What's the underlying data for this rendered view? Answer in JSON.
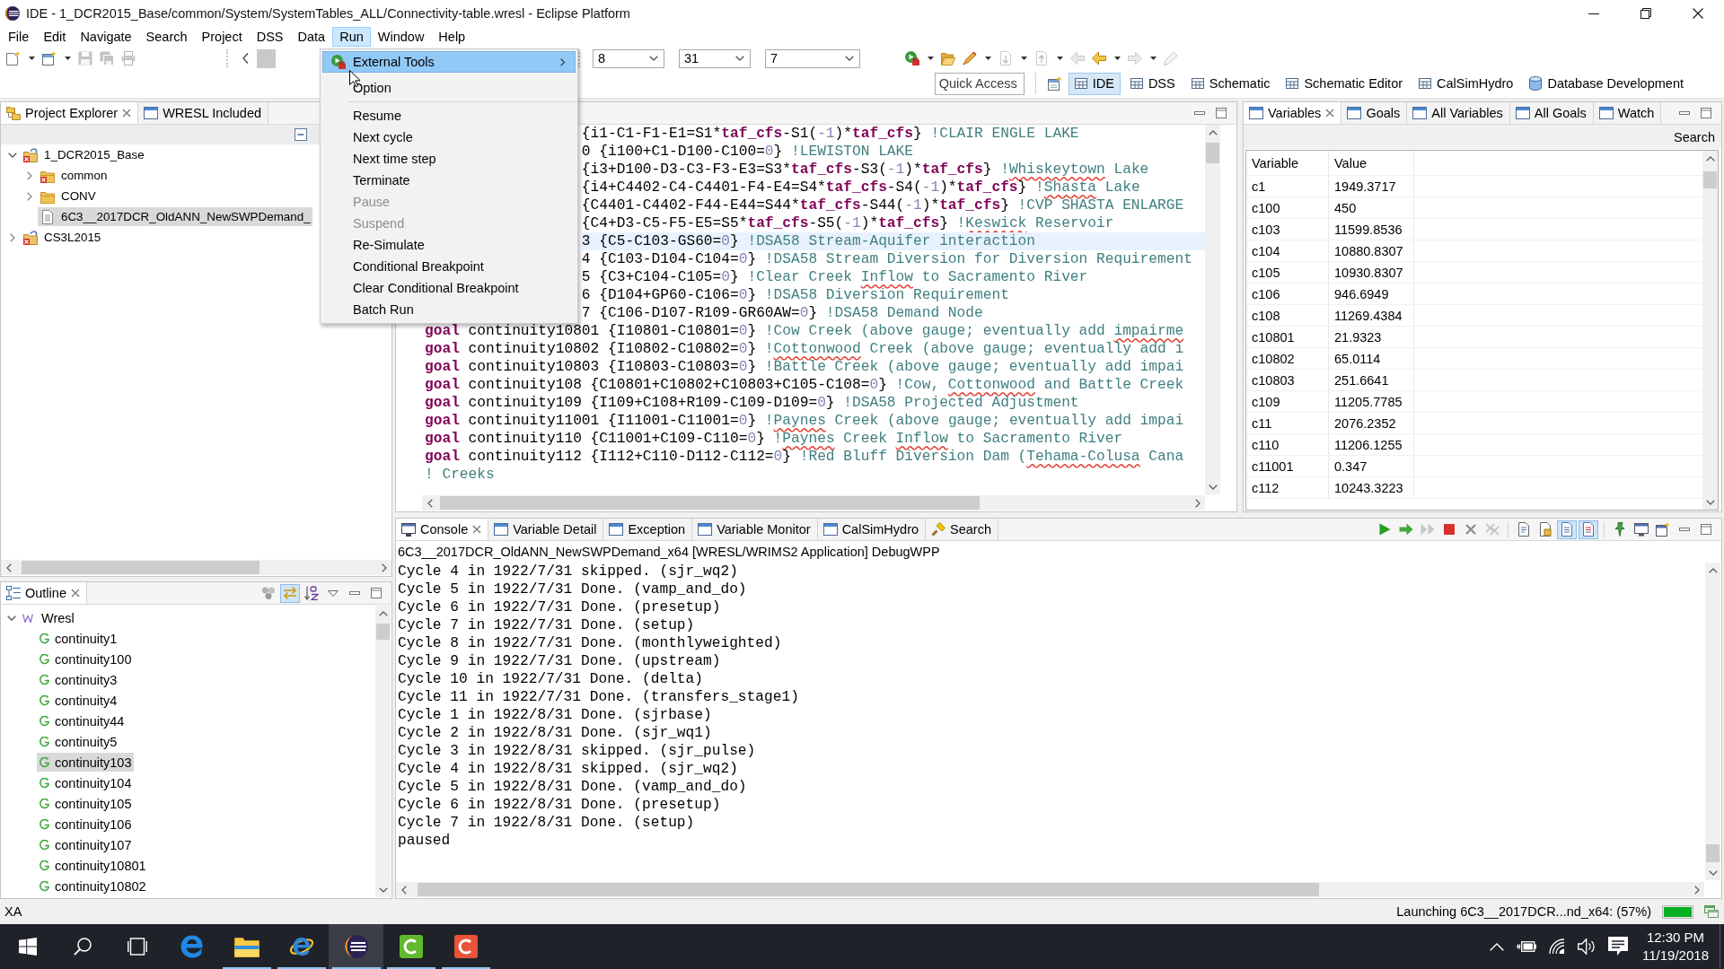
{
  "window": {
    "title": "IDE - 1_DCR2015_Base/common/System/SystemTables_ALL/Connectivity-table.wresl - Eclipse Platform"
  },
  "menu_bar": [
    {
      "label": "File",
      "selected": false
    },
    {
      "label": "Edit",
      "selected": false
    },
    {
      "label": "Navigate",
      "selected": false
    },
    {
      "label": "Search",
      "selected": false
    },
    {
      "label": "Project",
      "selected": false
    },
    {
      "label": "DSS",
      "selected": false
    },
    {
      "label": "Data",
      "selected": false
    },
    {
      "label": "Run",
      "selected": true
    },
    {
      "label": "Window",
      "selected": false
    },
    {
      "label": "Help",
      "selected": false
    }
  ],
  "toolbar": {
    "left_buttons": [
      {
        "kind": "new-file",
        "dropdown": true,
        "disabled": false
      },
      {
        "kind": "new-project",
        "dropdown": true,
        "disabled": false
      },
      {
        "kind": "save",
        "dropdown": false,
        "disabled": true
      },
      {
        "kind": "save-all",
        "dropdown": false,
        "disabled": true
      },
      {
        "kind": "print",
        "dropdown": false,
        "disabled": true
      }
    ],
    "combos": [
      {
        "value": "8"
      },
      {
        "value": "31"
      },
      {
        "value": "7"
      }
    ],
    "right_buttons": [
      {
        "kind": "run-tools",
        "dropdown": true,
        "disabled": false
      },
      {
        "kind": "open-folder",
        "dropdown": false,
        "disabled": false
      },
      {
        "kind": "brush",
        "dropdown": true,
        "disabled": false
      },
      {
        "kind": "page-down",
        "dropdown": true,
        "disabled": true
      },
      {
        "kind": "page-up",
        "dropdown": true,
        "disabled": true
      },
      {
        "kind": "back",
        "dropdown": false,
        "disabled": true
      },
      {
        "kind": "back",
        "dropdown": true,
        "disabled": false
      },
      {
        "kind": "forward",
        "dropdown": true,
        "disabled": true
      },
      {
        "kind": "pen",
        "dropdown": false,
        "disabled": true
      }
    ],
    "quick_access": {
      "placeholder": "Quick Access"
    },
    "perspectives": [
      {
        "label": "IDE",
        "kind": "table",
        "selected": true
      },
      {
        "label": "DSS",
        "kind": "table",
        "selected": false
      },
      {
        "label": "Schematic",
        "kind": "table",
        "selected": false
      },
      {
        "label": "Schematic Editor",
        "kind": "table",
        "selected": false
      },
      {
        "label": "CalSimHydro",
        "kind": "table",
        "selected": false
      },
      {
        "label": "Database Development",
        "kind": "database",
        "selected": false
      }
    ]
  },
  "run_menu": {
    "items": [
      {
        "label": "External Tools",
        "kind": "launcher",
        "selected": true,
        "disabled": false
      },
      {
        "label": "Option",
        "kind": "command",
        "selected": false,
        "disabled": false
      },
      {
        "kind": "separator"
      },
      {
        "label": "Resume",
        "kind": "command",
        "selected": false,
        "disabled": false
      },
      {
        "label": "Next cycle",
        "kind": "command",
        "selected": false,
        "disabled": false
      },
      {
        "label": "Next time step",
        "kind": "command",
        "selected": false,
        "disabled": false
      },
      {
        "label": "Terminate",
        "kind": "command",
        "selected": false,
        "disabled": false
      },
      {
        "label": "Pause",
        "kind": "command",
        "selected": false,
        "disabled": true
      },
      {
        "label": "Suspend",
        "kind": "command",
        "selected": false,
        "disabled": true
      },
      {
        "label": "Re-Simulate",
        "kind": "command",
        "selected": false,
        "disabled": false
      },
      {
        "label": "Conditional Breakpoint",
        "kind": "command",
        "selected": false,
        "disabled": false
      },
      {
        "label": "Clear Conditional Breakpoint",
        "kind": "command",
        "selected": false,
        "disabled": false
      },
      {
        "label": "Batch Run",
        "kind": "command",
        "selected": false,
        "disabled": false
      }
    ]
  },
  "project_explorer": {
    "tabs": [
      {
        "label": "Project Explorer",
        "kind": "explorer",
        "selected": true
      },
      {
        "label": "WRESL Included",
        "kind": "view",
        "selected": false
      }
    ],
    "tree": [
      {
        "label": "1_DCR2015_Base",
        "kind": "project",
        "error": true,
        "expanded": true,
        "selected": false,
        "children": [
          {
            "label": "common",
            "kind": "folder",
            "error": true,
            "expanded": false,
            "selected": false
          },
          {
            "label": "CONV",
            "kind": "folder",
            "error": false,
            "expanded": false,
            "selected": false
          },
          {
            "label": "6C3__2017DCR_OldANN_NewSWPDemand_",
            "kind": "file",
            "selected": true
          }
        ]
      },
      {
        "label": "CS3L2015",
        "kind": "project",
        "error": true,
        "expanded": false,
        "selected": false
      }
    ]
  },
  "outline": {
    "tabs": [
      {
        "label": "Outline",
        "kind": "outline",
        "selected": true
      }
    ],
    "toolbar": [
      {
        "kind": "filter",
        "on": false
      },
      {
        "kind": "link",
        "on": true
      },
      {
        "kind": "sort",
        "on": false
      }
    ],
    "tree": [
      {
        "label": "Wresl",
        "kind": "root",
        "expanded": true,
        "selected": false,
        "children": [
          {
            "label": "continuity1",
            "kind": "goal",
            "selected": false
          },
          {
            "label": "continuity100",
            "kind": "goal",
            "selected": false
          },
          {
            "label": "continuity3",
            "kind": "goal",
            "selected": false
          },
          {
            "label": "continuity4",
            "kind": "goal",
            "selected": false
          },
          {
            "label": "continuity44",
            "kind": "goal",
            "selected": false
          },
          {
            "label": "continuity5",
            "kind": "goal",
            "selected": false
          },
          {
            "label": "continuity103",
            "kind": "goal",
            "selected": true
          },
          {
            "label": "continuity104",
            "kind": "goal",
            "selected": false
          },
          {
            "label": "continuity105",
            "kind": "goal",
            "selected": false
          },
          {
            "label": "continuity106",
            "kind": "goal",
            "selected": false
          },
          {
            "label": "continuity107",
            "kind": "goal",
            "selected": false
          },
          {
            "label": "continuity10801",
            "kind": "goal",
            "selected": false
          },
          {
            "label": "continuity10802",
            "kind": "goal",
            "selected": false
          }
        ]
      }
    ]
  },
  "editor": {
    "lines": [
      {
        "kind": "partial",
        "current": false,
        "segments": [
          {
            "kind": "plain",
            "text": "{i1-C1-F1-E1=S1*"
          },
          {
            "kind": "var",
            "text": "taf_cfs"
          },
          {
            "kind": "plain",
            "text": "-S1("
          },
          {
            "kind": "number",
            "text": "-1"
          },
          {
            "kind": "plain",
            "text": ")*"
          },
          {
            "kind": "var",
            "text": "taf_cfs"
          },
          {
            "kind": "plain",
            "text": "}"
          },
          {
            "kind": "comment",
            "text": " !CLAIR ENGLE LAKE"
          }
        ]
      },
      {
        "kind": "partial",
        "current": false,
        "segments": [
          {
            "kind": "plain",
            "text": "0 {i100+C1-D100-C100="
          },
          {
            "kind": "number",
            "text": "0"
          },
          {
            "kind": "plain",
            "text": "}"
          },
          {
            "kind": "comment",
            "text": " !LEWISTON LAKE"
          }
        ]
      },
      {
        "kind": "partial",
        "current": false,
        "segments": [
          {
            "kind": "plain",
            "text": "{i3+D100-D3-C3-F3-E3=S3*"
          },
          {
            "kind": "var",
            "text": "taf_cfs"
          },
          {
            "kind": "plain",
            "text": "-S3("
          },
          {
            "kind": "number",
            "text": "-1"
          },
          {
            "kind": "plain",
            "text": ")*"
          },
          {
            "kind": "var",
            "text": "taf_cfs"
          },
          {
            "kind": "plain",
            "text": "}"
          },
          {
            "kind": "comment",
            "text": " !"
          },
          {
            "kind": "typo",
            "text": "Whiskeytown"
          },
          {
            "kind": "comment",
            "text": " Lake"
          }
        ]
      },
      {
        "kind": "partial",
        "current": false,
        "segments": [
          {
            "kind": "plain",
            "text": "{i4+C4402-C4-C4401-F4-E4=S4*"
          },
          {
            "kind": "var",
            "text": "taf_cfs"
          },
          {
            "kind": "plain",
            "text": "-S4("
          },
          {
            "kind": "number",
            "text": "-1"
          },
          {
            "kind": "plain",
            "text": ")*"
          },
          {
            "kind": "var",
            "text": "taf_cfs"
          },
          {
            "kind": "plain",
            "text": "}"
          },
          {
            "kind": "comment",
            "text": " !"
          },
          {
            "kind": "typo",
            "text": "Shasta"
          },
          {
            "kind": "comment",
            "text": " Lake"
          }
        ]
      },
      {
        "kind": "partial",
        "current": false,
        "segments": [
          {
            "kind": "plain",
            "text": "{C4401-C4402-F44-E44=S44*"
          },
          {
            "kind": "var",
            "text": "taf_cfs"
          },
          {
            "kind": "plain",
            "text": "-S44("
          },
          {
            "kind": "number",
            "text": "-1"
          },
          {
            "kind": "plain",
            "text": ")*"
          },
          {
            "kind": "var",
            "text": "taf_cfs"
          },
          {
            "kind": "plain",
            "text": "}"
          },
          {
            "kind": "comment",
            "text": " !CVP SHASTA ENLARGE"
          }
        ]
      },
      {
        "kind": "partial",
        "current": false,
        "segments": [
          {
            "kind": "plain",
            "text": "{C4+D3-C5-F5-E5=S5*"
          },
          {
            "kind": "var",
            "text": "taf_cfs"
          },
          {
            "kind": "plain",
            "text": "-S5("
          },
          {
            "kind": "number",
            "text": "-1"
          },
          {
            "kind": "plain",
            "text": ")*"
          },
          {
            "kind": "var",
            "text": "taf_cfs"
          },
          {
            "kind": "plain",
            "text": "}"
          },
          {
            "kind": "comment",
            "text": " !"
          },
          {
            "kind": "typo",
            "text": "Keswick"
          },
          {
            "kind": "comment",
            "text": " Reservoir"
          }
        ]
      },
      {
        "kind": "partial",
        "current": true,
        "segments": [
          {
            "kind": "plain",
            "text": "3 {C5-C103-GS60="
          },
          {
            "kind": "number",
            "text": "0"
          },
          {
            "kind": "plain",
            "text": "}"
          },
          {
            "kind": "comment",
            "text": " !DSA58 Stream-Aquifer interaction"
          }
        ]
      },
      {
        "kind": "partial",
        "current": false,
        "segments": [
          {
            "kind": "plain",
            "text": "4 {C103-D104-C104="
          },
          {
            "kind": "number",
            "text": "0"
          },
          {
            "kind": "plain",
            "text": "}"
          },
          {
            "kind": "comment",
            "text": " !DSA58 Stream Diversion for Diversion Requirement"
          }
        ]
      },
      {
        "kind": "partial",
        "current": false,
        "segments": [
          {
            "kind": "plain",
            "text": "5 {C3+C104-C105="
          },
          {
            "kind": "number",
            "text": "0"
          },
          {
            "kind": "plain",
            "text": "}"
          },
          {
            "kind": "comment",
            "text": " !Clear Creek "
          },
          {
            "kind": "typo",
            "text": "Inflow"
          },
          {
            "kind": "comment",
            "text": " to Sacramento River"
          }
        ]
      },
      {
        "kind": "partial",
        "current": false,
        "segments": [
          {
            "kind": "plain",
            "text": "6 {D104+GP60-C106="
          },
          {
            "kind": "number",
            "text": "0"
          },
          {
            "kind": "plain",
            "text": "}"
          },
          {
            "kind": "comment",
            "text": " !DSA58 Diversion Requirement"
          }
        ]
      },
      {
        "kind": "partial",
        "current": false,
        "segments": [
          {
            "kind": "plain",
            "text": "7 {C106-D107-R109-GR60AW="
          },
          {
            "kind": "number",
            "text": "0"
          },
          {
            "kind": "plain",
            "text": "}"
          },
          {
            "kind": "comment",
            "text": " !DSA58 Demand Node"
          }
        ]
      },
      {
        "kind": "full",
        "current": false,
        "segments": [
          {
            "kind": "keyword",
            "text": "goal"
          },
          {
            "kind": "plain",
            "text": " continuity10801 {I10801-C10801="
          },
          {
            "kind": "number",
            "text": "0"
          },
          {
            "kind": "plain",
            "text": "}"
          },
          {
            "kind": "comment",
            "text": " !Cow Creek (above gauge; eventually add "
          },
          {
            "kind": "typo",
            "text": "impairme"
          }
        ]
      },
      {
        "kind": "full",
        "current": false,
        "segments": [
          {
            "kind": "keyword",
            "text": "goal"
          },
          {
            "kind": "plain",
            "text": " continuity10802 {I10802-C10802="
          },
          {
            "kind": "number",
            "text": "0"
          },
          {
            "kind": "plain",
            "text": "}"
          },
          {
            "kind": "comment",
            "text": " !"
          },
          {
            "kind": "typo",
            "text": "Cottonwood"
          },
          {
            "kind": "comment",
            "text": " Creek (above gauge; eventually add i"
          }
        ]
      },
      {
        "kind": "full",
        "current": false,
        "segments": [
          {
            "kind": "keyword",
            "text": "goal"
          },
          {
            "kind": "plain",
            "text": " continuity10803 {I10803-C10803="
          },
          {
            "kind": "number",
            "text": "0"
          },
          {
            "kind": "plain",
            "text": "}"
          },
          {
            "kind": "comment",
            "text": " !Battle Creek (above gauge; eventually add impai"
          }
        ]
      },
      {
        "kind": "full",
        "current": false,
        "segments": [
          {
            "kind": "keyword",
            "text": "goal"
          },
          {
            "kind": "plain",
            "text": " continuity108 {C10801+C10802+C10803+C105-C108="
          },
          {
            "kind": "number",
            "text": "0"
          },
          {
            "kind": "plain",
            "text": "}"
          },
          {
            "kind": "comment",
            "text": " !Cow, "
          },
          {
            "kind": "typo",
            "text": "Cottonwood"
          },
          {
            "kind": "comment",
            "text": " and Battle Creek"
          }
        ]
      },
      {
        "kind": "full",
        "current": false,
        "segments": [
          {
            "kind": "keyword",
            "text": "goal"
          },
          {
            "kind": "plain",
            "text": " continuity109 {I109+C108+R109-C109-D109="
          },
          {
            "kind": "number",
            "text": "0"
          },
          {
            "kind": "plain",
            "text": "}"
          },
          {
            "kind": "comment",
            "text": " !DSA58 Projected Adjustment"
          }
        ]
      },
      {
        "kind": "full",
        "current": false,
        "segments": [
          {
            "kind": "keyword",
            "text": "goal"
          },
          {
            "kind": "plain",
            "text": " continuity11001 {I11001-C11001="
          },
          {
            "kind": "number",
            "text": "0"
          },
          {
            "kind": "plain",
            "text": "}"
          },
          {
            "kind": "comment",
            "text": " !"
          },
          {
            "kind": "typo",
            "text": "Paynes"
          },
          {
            "kind": "comment",
            "text": " Creek (above gauge; eventually add impai"
          }
        ]
      },
      {
        "kind": "full",
        "current": false,
        "segments": [
          {
            "kind": "keyword",
            "text": "goal"
          },
          {
            "kind": "plain",
            "text": " continuity110 {C11001+C109-C110="
          },
          {
            "kind": "number",
            "text": "0"
          },
          {
            "kind": "plain",
            "text": "}"
          },
          {
            "kind": "comment",
            "text": " !"
          },
          {
            "kind": "typo",
            "text": "Paynes"
          },
          {
            "kind": "comment",
            "text": " Creek "
          },
          {
            "kind": "typo",
            "text": "Inflow"
          },
          {
            "kind": "comment",
            "text": " to Sacramento River"
          }
        ]
      },
      {
        "kind": "full",
        "current": false,
        "segments": [
          {
            "kind": "keyword",
            "text": "goal"
          },
          {
            "kind": "plain",
            "text": " continuity112 {I112+C110-D112-C112="
          },
          {
            "kind": "number",
            "text": "0"
          },
          {
            "kind": "plain",
            "text": "}"
          },
          {
            "kind": "comment",
            "text": " !Red Bluff Diversion Dam ("
          },
          {
            "kind": "typo",
            "text": "Tehama-Colusa"
          },
          {
            "kind": "comment",
            "text": " Cana"
          }
        ]
      },
      {
        "kind": "full",
        "current": false,
        "segments": [
          {
            "kind": "comment",
            "text": "! Creeks"
          }
        ]
      }
    ]
  },
  "variables_view": {
    "tabs": [
      {
        "label": "Variables",
        "kind": "view",
        "selected": true
      },
      {
        "label": "Goals",
        "kind": "view",
        "selected": false
      },
      {
        "label": "All Variables",
        "kind": "view",
        "selected": false
      },
      {
        "label": "All Goals",
        "kind": "view",
        "selected": false
      },
      {
        "label": "Watch",
        "kind": "view",
        "selected": false
      }
    ],
    "search": "Search",
    "columns": [
      "Variable",
      "Value"
    ],
    "rows": [
      [
        "c1",
        "1949.3717"
      ],
      [
        "c100",
        "450"
      ],
      [
        "c103",
        "11599.8536"
      ],
      [
        "c104",
        "10880.8307"
      ],
      [
        "c105",
        "10930.8307"
      ],
      [
        "c106",
        "946.6949"
      ],
      [
        "c108",
        "11269.4384"
      ],
      [
        "c10801",
        "21.9323"
      ],
      [
        "c10802",
        "65.0114"
      ],
      [
        "c10803",
        "251.6641"
      ],
      [
        "c109",
        "11205.7785"
      ],
      [
        "c11",
        "2076.2352"
      ],
      [
        "c110",
        "11206.1255"
      ],
      [
        "c11001",
        "0.347"
      ],
      [
        "c112",
        "10243.3223"
      ]
    ]
  },
  "console": {
    "tabs": [
      {
        "label": "Console",
        "kind": "console",
        "selected": true
      },
      {
        "label": "Variable Detail",
        "kind": "view",
        "selected": false
      },
      {
        "label": "Exception",
        "kind": "view",
        "selected": false
      },
      {
        "label": "Variable Monitor",
        "kind": "view",
        "selected": false
      },
      {
        "label": "CalSimHydro",
        "kind": "view",
        "selected": false
      },
      {
        "label": "Search",
        "kind": "search",
        "selected": false
      }
    ],
    "toolbar": [
      {
        "kind": "run",
        "disabled": false,
        "on": false
      },
      {
        "kind": "step",
        "disabled": false,
        "on": false
      },
      {
        "kind": "resume",
        "disabled": true,
        "on": false
      },
      {
        "kind": "terminate",
        "disabled": false,
        "on": false
      },
      {
        "kind": "remove",
        "disabled": false,
        "on": false
      },
      {
        "kind": "remove-all",
        "disabled": true,
        "on": false
      },
      {
        "kind": "separator"
      },
      {
        "kind": "clear",
        "disabled": false,
        "on": false
      },
      {
        "kind": "scroll-lock",
        "disabled": false,
        "on": false
      },
      {
        "kind": "show-out",
        "disabled": false,
        "on": true
      },
      {
        "kind": "show-err",
        "disabled": false,
        "on": true
      },
      {
        "kind": "separator"
      },
      {
        "kind": "pin",
        "disabled": false,
        "on": false
      },
      {
        "kind": "display",
        "disabled": false,
        "on": false
      },
      {
        "kind": "new-console",
        "disabled": false,
        "on": false
      }
    ],
    "process": "6C3__2017DCR_OldANN_NewSWPDemand_x64 [WRESL/WRIMS2 Application] DebugWPP",
    "lines": [
      "Cycle 4 in 1922/7/31 skipped. (sjr_wq2)",
      "Cycle 5 in 1922/7/31 Done. (vamp_and_do)",
      "Cycle 6 in 1922/7/31 Done. (presetup)",
      "Cycle 7 in 1922/7/31 Done. (setup)",
      "Cycle 8 in 1922/7/31 Done. (monthlyweighted)",
      "Cycle 9 in 1922/7/31 Done. (upstream)",
      "Cycle 10 in 1922/7/31 Done. (delta)",
      "Cycle 11 in 1922/7/31 Done. (transfers_stage1)",
      "Cycle 1 in 1922/8/31 Done. (sjrbase)",
      "Cycle 2 in 1922/8/31 Done. (sjr_wq1)",
      "Cycle 3 in 1922/8/31 skipped. (sjr_pulse)",
      "Cycle 4 in 1922/8/31 skipped. (sjr_wq2)",
      "Cycle 5 in 1922/8/31 Done. (vamp_and_do)",
      "Cycle 6 in 1922/8/31 Done. (presetup)",
      "Cycle 7 in 1922/8/31 Done. (setup)",
      "paused"
    ]
  },
  "status_bar": {
    "message": "XA",
    "task": "Launching 6C3__2017DCR...nd_x64: (57%)",
    "level": 1
  },
  "taskbar": {
    "buttons": [
      {
        "kind": "start",
        "running": false,
        "selected": false
      },
      {
        "kind": "search",
        "running": false,
        "selected": false
      },
      {
        "kind": "task-view",
        "running": false,
        "selected": false
      },
      {
        "kind": "edge",
        "running": false,
        "selected": false
      },
      {
        "kind": "explorer",
        "running": true,
        "selected": false
      },
      {
        "kind": "ie",
        "running": true,
        "selected": false
      },
      {
        "kind": "eclipse",
        "running": true,
        "selected": true
      },
      {
        "kind": "tile-green",
        "running": true,
        "selected": false
      },
      {
        "kind": "tile-red",
        "running": true,
        "selected": false
      }
    ],
    "time": "12:30 PM",
    "date": "11/19/2018"
  }
}
